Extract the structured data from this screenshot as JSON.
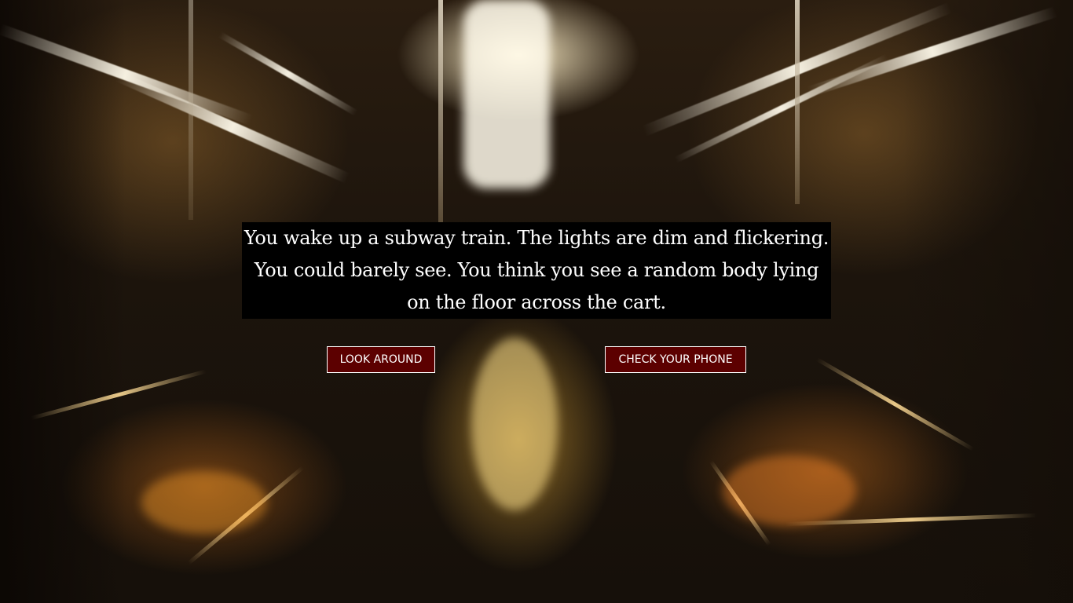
{
  "story": {
    "text": "You wake up a subway train. The lights are dim and flickering. You could barely see. You think you see a random body lying on the floor across the cart."
  },
  "choices": [
    {
      "label": "LOOK AROUND"
    },
    {
      "label": "CHECK YOUR PHONE"
    }
  ],
  "colors": {
    "story_box_bg": "#000000",
    "story_text": "#ffffff",
    "button_bg": "#5c0000",
    "button_border": "#ffffff"
  }
}
